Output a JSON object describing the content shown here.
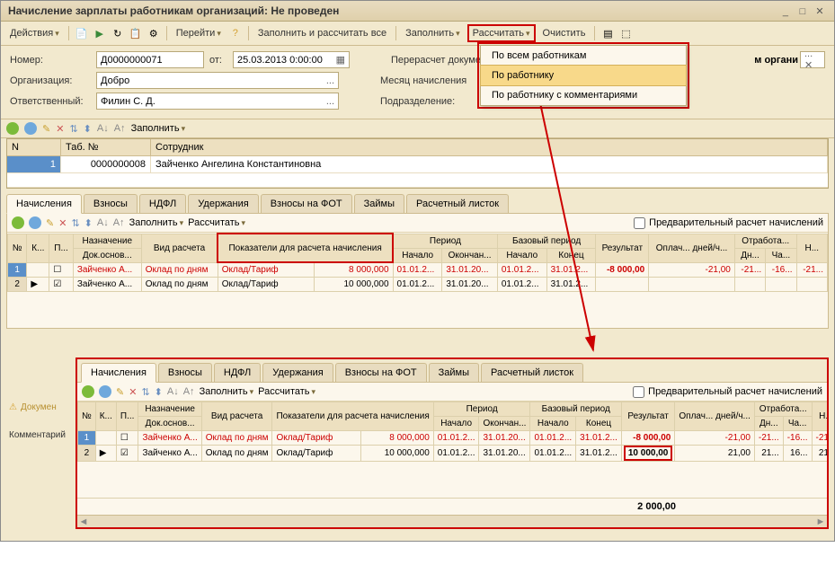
{
  "window": {
    "title": "Начисление зарплаты работникам организаций: Не проведен"
  },
  "toolbar": {
    "actions": "Действия",
    "go": "Перейти",
    "fill_calc_all": "Заполнить и рассчитать все",
    "fill": "Заполнить",
    "calc": "Рассчитать",
    "clear": "Очистить"
  },
  "menu": {
    "all": "По всем работникам",
    "one": "По работнику",
    "comm": "По работнику с комментариями"
  },
  "form": {
    "number_lbl": "Номер:",
    "number": "Д0000000071",
    "from_lbl": "от:",
    "from": "25.03.2013 0:00:00",
    "org_lbl": "Организация:",
    "org": "Добро",
    "resp_lbl": "Ответственный:",
    "resp": "Филин С. Д.",
    "recalc_lbl": "Перерасчет докуме",
    "org_right": "м органи",
    "month_lbl": "Месяц начисления",
    "subdiv_lbl": "Подразделение:"
  },
  "employee_table": {
    "n": "N",
    "tab": "Таб. №",
    "emp": "Сотрудник",
    "row_n": "1",
    "row_tab": "0000000008",
    "row_emp": "Зайченко Ангелина Константиновна"
  },
  "tabs": {
    "a": "Начисления",
    "b": "Взносы",
    "c": "НДФЛ",
    "d": "Удержания",
    "e": "Взносы на ФОТ",
    "f": "Займы",
    "g": "Расчетный листок"
  },
  "subbar": {
    "fill": "Заполнить",
    "calc": "Рассчитать",
    "prelim": "Предварительный расчет начислений"
  },
  "grid": {
    "h_n": "№",
    "h_k": "К...",
    "h_p": "П...",
    "h_name": "Назначение",
    "h_doc": "Док.основ...",
    "h_type": "Вид расчета",
    "h_ind": "Показатели для расчета начисления",
    "h_period": "Период",
    "h_start": "Начало",
    "h_end": "Окончан...",
    "h_base": "Базовый период",
    "h_bs": "Начало",
    "h_be": "Конец",
    "h_res": "Результат",
    "h_paid": "Оплач... дней/ч...",
    "h_work": "Отработа...",
    "h_dn": "Дн...",
    "h_ch": "Ча...",
    "h_dn2": "Дн...",
    "h_h": "Н...",
    "rows": [
      {
        "n": "1",
        "name": "Зайченко А...",
        "type": "Оклад по дням",
        "ind": "Оклад/Тариф",
        "val": "8 000,000",
        "s": "01.01.2...",
        "e": "31.01.20...",
        "bs": "01.01.2...",
        "be": "31.01.2...",
        "res": "-8 000,00",
        "paid": "-21,00",
        "dn": "-21...",
        "ch": "-16...",
        "dn2": "-21...",
        "red": true
      },
      {
        "n": "2",
        "name": "Зайченко А...",
        "type": "Оклад по дням",
        "ind": "Оклад/Тариф",
        "val": "10 000,000",
        "s": "01.01.2...",
        "e": "31.01.20...",
        "bs": "01.01.2...",
        "be": "31.01.2...",
        "res": "",
        "paid": "",
        "dn": "",
        "ch": "",
        "dn2": "",
        "red": false,
        "chk": true
      }
    ]
  },
  "grid2": {
    "rows": [
      {
        "n": "1",
        "name": "Зайченко А...",
        "type": "Оклад по дням",
        "ind": "Оклад/Тариф",
        "val": "8 000,000",
        "s": "01.01.2...",
        "e": "31.01.20...",
        "bs": "01.01.2...",
        "be": "31.01.2...",
        "res": "-8 000,00",
        "paid": "-21,00",
        "dn": "-21...",
        "ch": "-16...",
        "dn2": "-21...",
        "red": true
      },
      {
        "n": "2",
        "name": "Зайченко А...",
        "type": "Оклад по дням",
        "ind": "Оклад/Тариф",
        "val": "10 000,000",
        "s": "01.01.2...",
        "e": "31.01.20...",
        "bs": "01.01.2...",
        "be": "31.01.2...",
        "res": "10 000,00",
        "paid": "21,00",
        "dn": "21...",
        "ch": "16...",
        "dn2": "21...",
        "red": false,
        "chk": true
      }
    ],
    "total": "2 000,00"
  },
  "hints": {
    "doc": "Докумен",
    "comm": "Комментарий"
  }
}
